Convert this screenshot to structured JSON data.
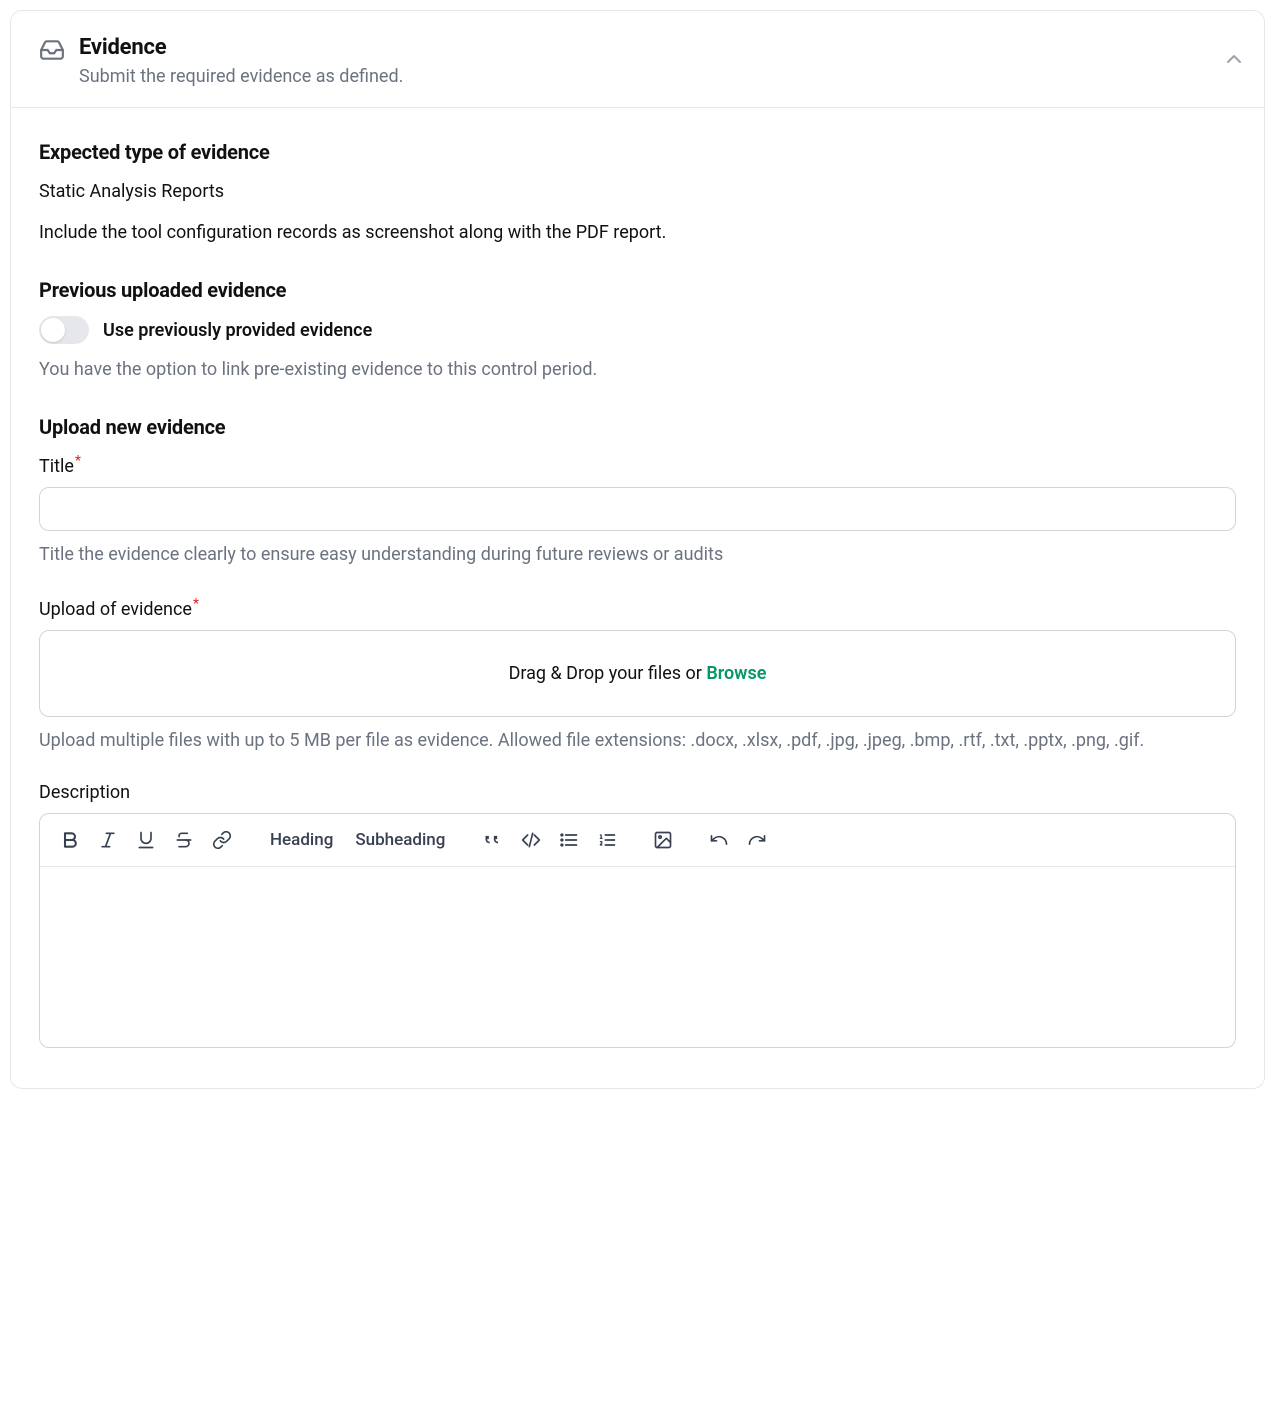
{
  "header": {
    "title": "Evidence",
    "subtitle": "Submit the required evidence as defined."
  },
  "expected": {
    "heading": "Expected type of evidence",
    "type": "Static Analysis Reports",
    "instruction": "Include the  tool configuration records as screenshot along with the PDF report."
  },
  "previous": {
    "heading": "Previous uploaded evidence",
    "toggle_label": "Use previously provided evidence",
    "helper": "You have the option to link pre-existing evidence to this control period."
  },
  "upload": {
    "heading": "Upload new evidence",
    "title_label": "Title",
    "title_value": "",
    "title_helper": "Title the evidence clearly to ensure easy understanding during future reviews or audits",
    "file_label": "Upload of evidence",
    "dropzone_text": "Drag & Drop your files or ",
    "dropzone_browse": "Browse",
    "file_helper": "Upload multiple files with up to 5 MB per file as evidence. Allowed file extensions: .docx, .xlsx, .pdf, .jpg, .jpeg, .bmp, .rtf, .txt, .pptx, .png, .gif.",
    "description_label": "Description"
  },
  "toolbar": {
    "heading_label": "Heading",
    "subheading_label": "Subheading"
  }
}
